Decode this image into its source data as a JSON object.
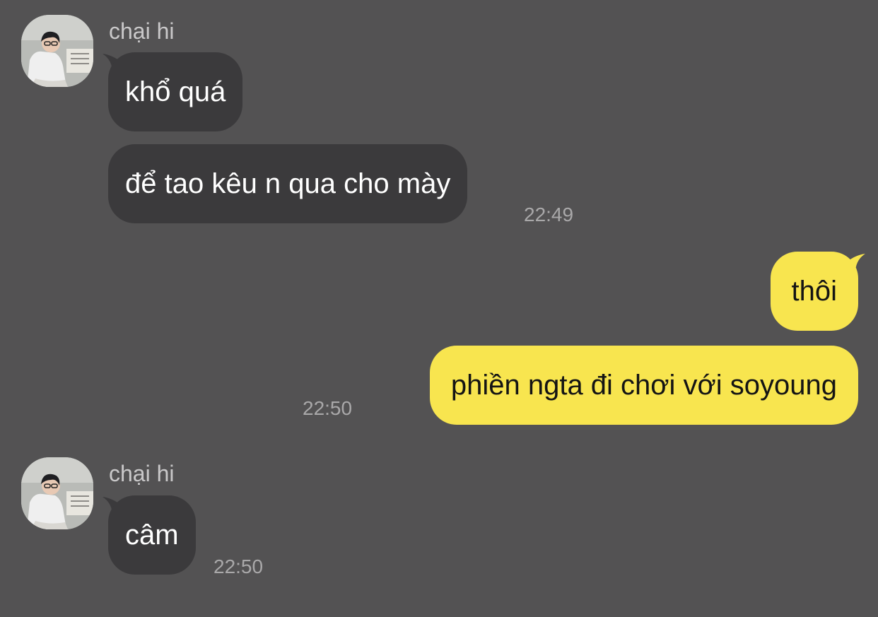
{
  "colors": {
    "background": "#535253",
    "incoming_bubble": "#3b3a3c",
    "outgoing_bubble": "#f8e54f",
    "incoming_text": "#ffffff",
    "outgoing_text": "#141414",
    "meta_text": "#a9a8a9"
  },
  "chat": {
    "groups": [
      {
        "sender": "chại hi",
        "avatar_icon": "profile-photo-avatar",
        "messages": [
          {
            "text": "khổ quá"
          },
          {
            "text": "để tao kêu n qua cho mày",
            "time": "22:49"
          }
        ]
      },
      {
        "sender": "me",
        "messages": [
          {
            "text": "thôi"
          },
          {
            "text": "phiền ngta đi chơi với soyoung",
            "time": "22:50"
          }
        ]
      },
      {
        "sender": "chại hi",
        "avatar_icon": "profile-photo-avatar",
        "messages": [
          {
            "text": "câm",
            "time": "22:50"
          }
        ]
      }
    ]
  }
}
